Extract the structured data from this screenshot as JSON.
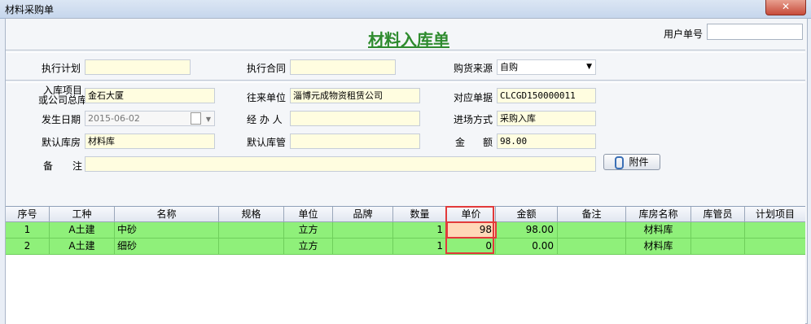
{
  "window": {
    "title": "材料采购单",
    "close": "✕"
  },
  "form": {
    "title": "材料入库单",
    "user_no_label": "用户单号",
    "user_no_value": "",
    "exec_plan": {
      "label": "执行计划",
      "value": ""
    },
    "exec_contract": {
      "label": "执行合同",
      "value": ""
    },
    "purchase_source": {
      "label": "购货来源",
      "value": "自购"
    },
    "project": {
      "label_line1": "入库项目",
      "label_line2": "或公司总库",
      "value": "金石大厦"
    },
    "counterparty": {
      "label": "往来单位",
      "value": "淄博元成物资租赁公司"
    },
    "ref_doc": {
      "label": "对应单据",
      "value": "CLCGD150000011"
    },
    "date": {
      "label": "发生日期",
      "value": "2015-06-02"
    },
    "handler": {
      "label": "经 办 人",
      "value": ""
    },
    "entry_mode": {
      "label": "进场方式",
      "value": "采购入库"
    },
    "warehouse": {
      "label": "默认库房",
      "value": "材料库"
    },
    "keeper": {
      "label": "默认库管",
      "value": ""
    },
    "amount": {
      "label_a": "金",
      "label_b": "额",
      "value": "98.00"
    },
    "remark": {
      "label_a": "备",
      "label_b": "注",
      "value": ""
    },
    "attach_button": "附件"
  },
  "grid": {
    "columns": [
      "序号",
      "工种",
      "名称",
      "规格",
      "单位",
      "品牌",
      "数量",
      "单价",
      "金额",
      "备注",
      "库房名称",
      "库管员",
      "计划项目"
    ],
    "rows": [
      [
        "1",
        "A土建",
        "中砂",
        "",
        "立方",
        "",
        "1",
        "98",
        "98.00",
        "",
        "材料库",
        "",
        ""
      ],
      [
        "2",
        "A土建",
        "细砂",
        "",
        "立方",
        "",
        "1",
        "0",
        "0.00",
        "",
        "材料库",
        "",
        ""
      ]
    ]
  },
  "colors": {
    "row_green": "#8ff07a",
    "title_green": "#2e8b2e",
    "highlight_red": "#e23a3a"
  }
}
